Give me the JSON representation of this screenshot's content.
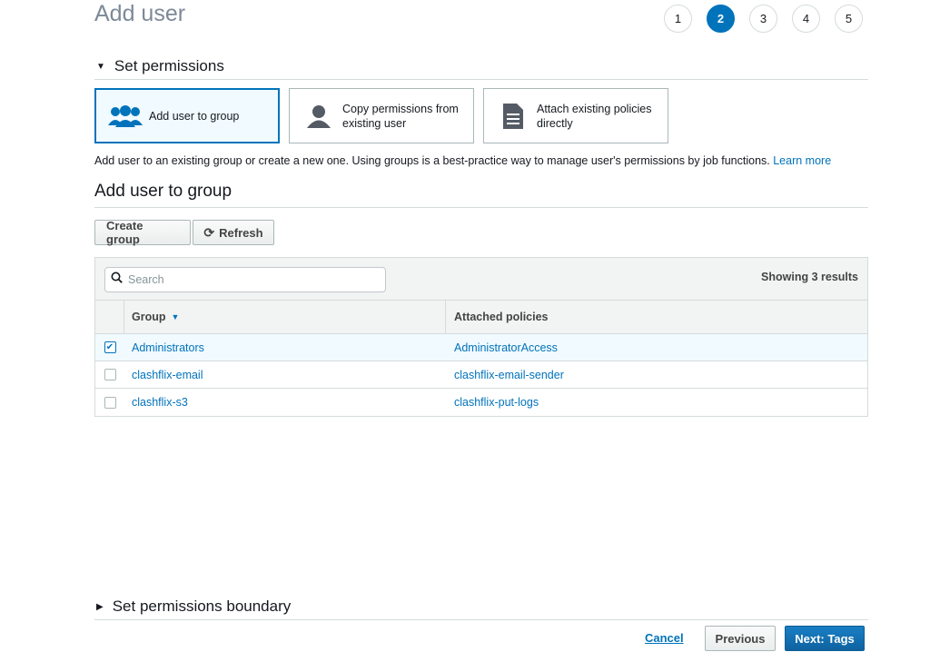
{
  "page": {
    "title": "Add user"
  },
  "steps": [
    "1",
    "2",
    "3",
    "4",
    "5"
  ],
  "active_step": "2",
  "set_permissions": {
    "header": "Set permissions",
    "options": [
      {
        "label_line1": "Add user to group",
        "label_line2": "",
        "icon": "users-group-icon"
      },
      {
        "label_line1": "Copy permissions from",
        "label_line2": "existing user",
        "icon": "user-icon"
      },
      {
        "label_line1": "Attach existing policies",
        "label_line2": "directly",
        "icon": "document-icon"
      }
    ],
    "description": "Add user to an existing group or create a new one. Using groups is a best-practice way to manage user's permissions by job functions.",
    "learn_more": "Learn more"
  },
  "group_section": {
    "heading": "Add user to group",
    "create_group_label": "Create group",
    "refresh_label": "Refresh",
    "search_placeholder": "Search",
    "results_text": "Showing 3 results",
    "columns": {
      "group": "Group",
      "policies": "Attached policies"
    },
    "rows": [
      {
        "group": "Administrators",
        "policy": "AdministratorAccess",
        "checked": true
      },
      {
        "group": "clashflix-email",
        "policy": "clashflix-email-sender",
        "checked": false
      },
      {
        "group": "clashflix-s3",
        "policy": "clashflix-put-logs",
        "checked": false
      }
    ]
  },
  "boundary": {
    "header": "Set permissions boundary"
  },
  "footer": {
    "cancel": "Cancel",
    "previous": "Previous",
    "next": "Next: Tags"
  },
  "colors": {
    "accent": "#0073bb",
    "selected_bg": "#f1faff",
    "border": "#d5dbdb"
  }
}
